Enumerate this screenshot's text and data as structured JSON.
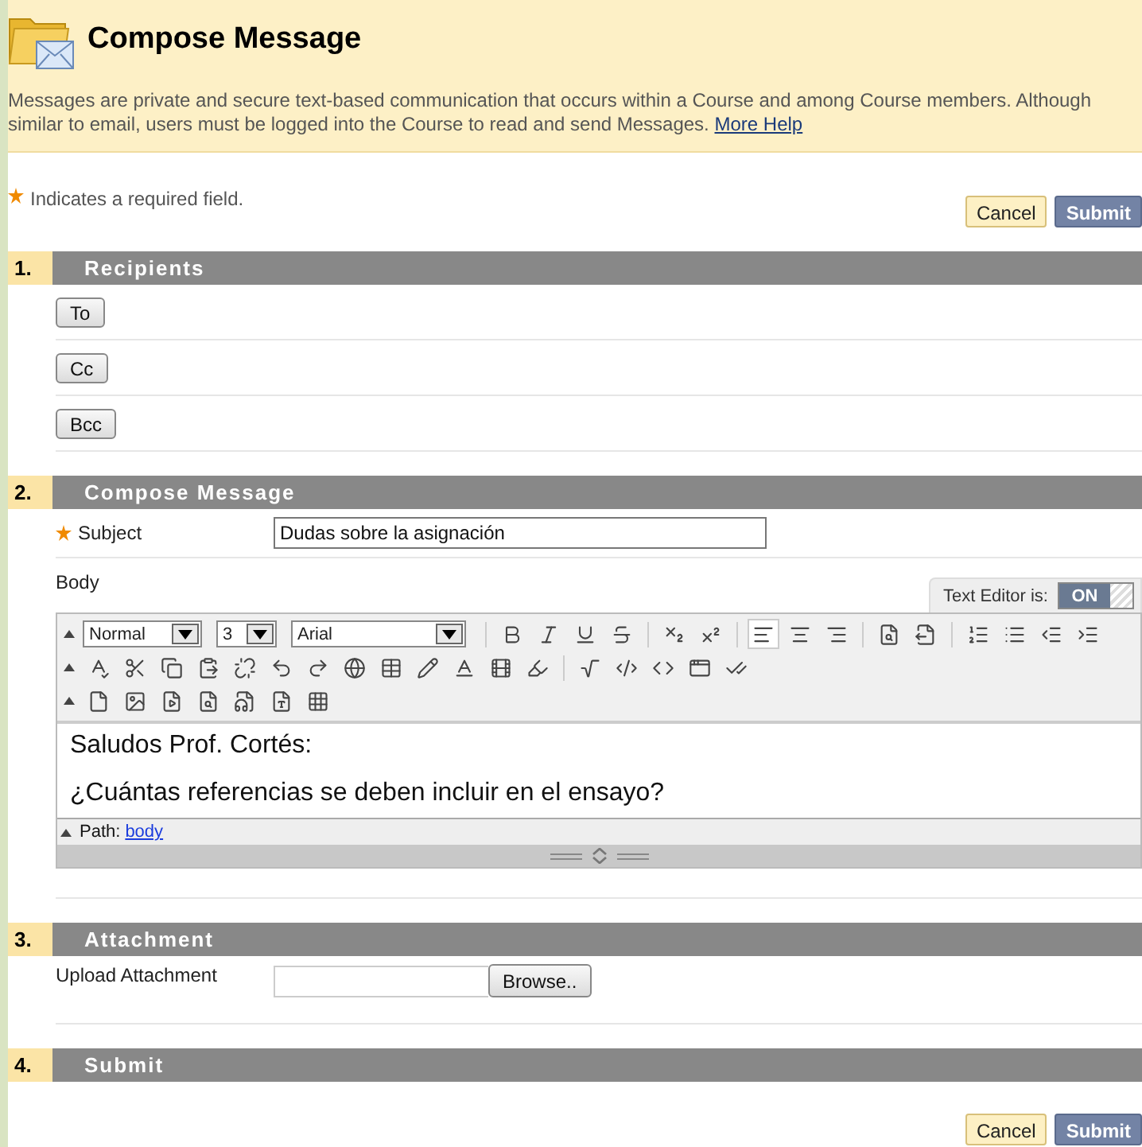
{
  "header": {
    "title": "Compose Message",
    "description": "Messages are private and secure text-based communication that occurs within a Course and among Course members. Although similar to email, users must be logged into the Course to read and send Messages.",
    "help_link": "More Help"
  },
  "required_note": {
    "text": "Indicates a required field."
  },
  "top_buttons": [
    {
      "label": "Cancel",
      "kind": "cancel"
    },
    {
      "label": "Submit",
      "kind": "submit"
    }
  ],
  "sections": [
    {
      "number": "1.",
      "title": "Recipients",
      "kind": "recipients",
      "buttons": [
        "To",
        "Cc",
        "Bcc"
      ]
    },
    {
      "number": "2.",
      "title": "Compose Message",
      "kind": "compose",
      "subject": {
        "label": "Subject",
        "required": true,
        "value": "Dudas sobre la asignación"
      },
      "body_label": "Body",
      "text_editor": {
        "label": "Text Editor is:",
        "state_text": "ON",
        "on": true
      },
      "format": "Normal",
      "size": "3",
      "font": "Arial",
      "alignments": [
        {
          "kind": "left",
          "selected": true
        },
        {
          "kind": "center",
          "selected": false
        },
        {
          "kind": "right",
          "selected": false
        }
      ],
      "content": [
        "Saludos Prof. Cortés:",
        "¿Cuántas referencias se deben incluir en el ensayo?"
      ],
      "path_label": "Path:",
      "path_link": "body"
    },
    {
      "number": "3.",
      "title": "Attachment",
      "kind": "attachment",
      "label": "Upload Attachment",
      "browse": "Browse.."
    },
    {
      "number": "4.",
      "title": "Submit",
      "kind": "submit",
      "buttons": [
        {
          "label": "Cancel",
          "kind": "cancel"
        },
        {
          "label": "Submit",
          "kind": "submit"
        }
      ]
    }
  ]
}
